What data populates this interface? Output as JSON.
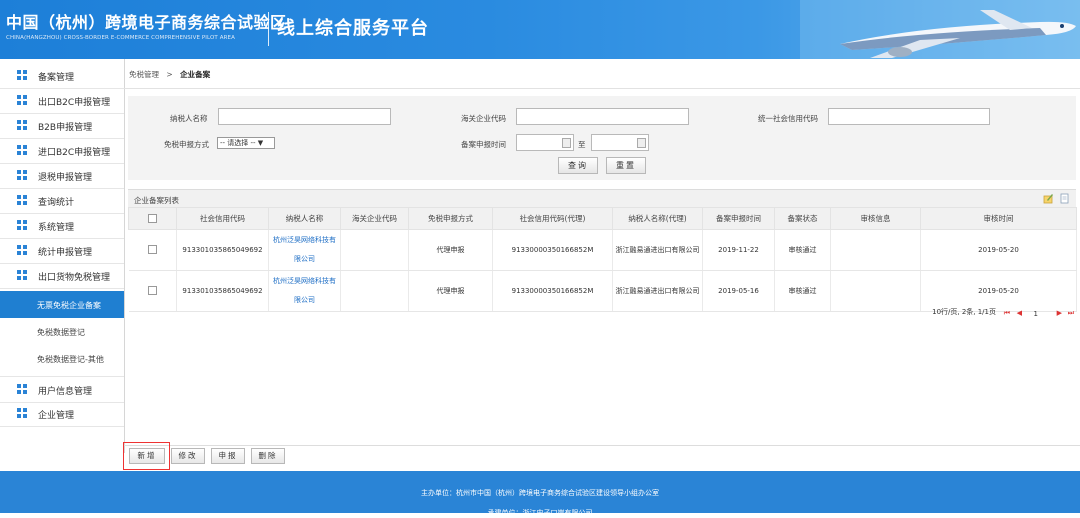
{
  "header": {
    "title": "中国（杭州）跨境电子商务综合试验区",
    "subtitle": "CHINA(HANGZHOU) CROSS-BORDER E-COMMERCE COMPREHENSIVE PILOT AREA",
    "platform": "线上综合服务平台"
  },
  "sidebar": {
    "items": [
      {
        "label": "备案管理"
      },
      {
        "label": "出口B2C申报管理"
      },
      {
        "label": "B2B申报管理"
      },
      {
        "label": "进口B2C申报管理"
      },
      {
        "label": "退税申报管理"
      },
      {
        "label": "查询统计"
      },
      {
        "label": "系统管理"
      },
      {
        "label": "统计申报管理"
      },
      {
        "label": "出口货物免税管理"
      }
    ],
    "sub_items": [
      {
        "label": "无票免税企业备案"
      },
      {
        "label": "免税数据登记"
      },
      {
        "label": "免税数据登记-其他"
      }
    ],
    "bottom_items": [
      {
        "label": "用户信息管理"
      },
      {
        "label": "企业管理"
      }
    ]
  },
  "breadcrumb": {
    "parent": "免税管理",
    "sep": ">",
    "current": "企业备案"
  },
  "search": {
    "taxpayer_name_label": "纳税人名称",
    "customs_code_label": "海关企业代码",
    "credit_code_label": "统一社会信用代码",
    "exempt_mode_label": "免税申报方式",
    "exempt_mode_value": "-- 请选择 -- ▼",
    "filing_time_label": "备案申报时间",
    "to_label": "至",
    "query_button": "查询",
    "reset_button": "重置"
  },
  "list": {
    "title": "企业备案列表",
    "columns": [
      "社会信用代码",
      "纳税人名称",
      "海关企业代码",
      "免税申报方式",
      "社会信用代码(代理)",
      "纳税人名称(代理)",
      "备案申报时间",
      "备案状态",
      "审核信息",
      "审核时间"
    ],
    "rows": [
      {
        "credit": "913301035865049692",
        "name": "杭州泛昊网络科技有限公司",
        "customs": "",
        "mode": "代理申报",
        "agent_credit": "91330000350166852M",
        "agent_name": "浙江融易通进出口有限公司",
        "filed": "2019-11-22",
        "status": "审核通过",
        "audit_info": "",
        "audit_time": "2019-05-20"
      },
      {
        "credit": "913301035865049692",
        "name": "杭州泛昊网络科技有限公司",
        "customs": "",
        "mode": "代理申报",
        "agent_credit": "91330000350166852M",
        "agent_name": "浙江融易通进出口有限公司",
        "filed": "2019-05-16",
        "status": "审核通过",
        "audit_info": "",
        "audit_time": "2019-05-20"
      }
    ],
    "pager_text": "10行/页, 2条, 1/1页",
    "page": "1"
  },
  "actions": {
    "add": "新增",
    "edit": "修改",
    "declare": "申报",
    "delete": "删除"
  },
  "footer": {
    "line1": "主办单位：杭州市中国（杭州）跨境电子商务综合试验区建设领导小组办公室",
    "line2": "承建单位：浙江电子口岸有限公司"
  },
  "colors": {
    "primary": "#2a84d6",
    "active": "#1f7fd1",
    "highlight": "#e33333"
  }
}
